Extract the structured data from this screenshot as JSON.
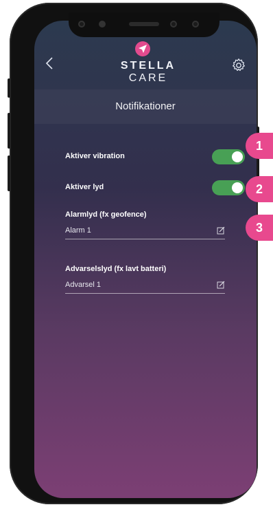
{
  "header": {
    "brand_bold": "STELLA",
    "brand_light": "CARE",
    "back_label": "<",
    "icons": {
      "back": "chevron-left-icon",
      "settings": "gear-icon",
      "logo": "paper-plane-icon"
    }
  },
  "page": {
    "title": "Notifikationer"
  },
  "settings": {
    "vibration": {
      "label": "Aktiver vibration",
      "on": true
    },
    "sound": {
      "label": "Aktiver lyd",
      "on": true
    },
    "alarm_sound": {
      "label": "Alarmlyd (fx geofence)",
      "value": "Alarm 1"
    },
    "warning_sound": {
      "label": "Advarselslyd (fx lavt batteri)",
      "value": "Advarsel 1"
    }
  },
  "badges": [
    "1",
    "2",
    "3"
  ],
  "colors": {
    "toggle_on": "#48a055",
    "badge": "#e8498e",
    "logo": "#e24b8e"
  }
}
